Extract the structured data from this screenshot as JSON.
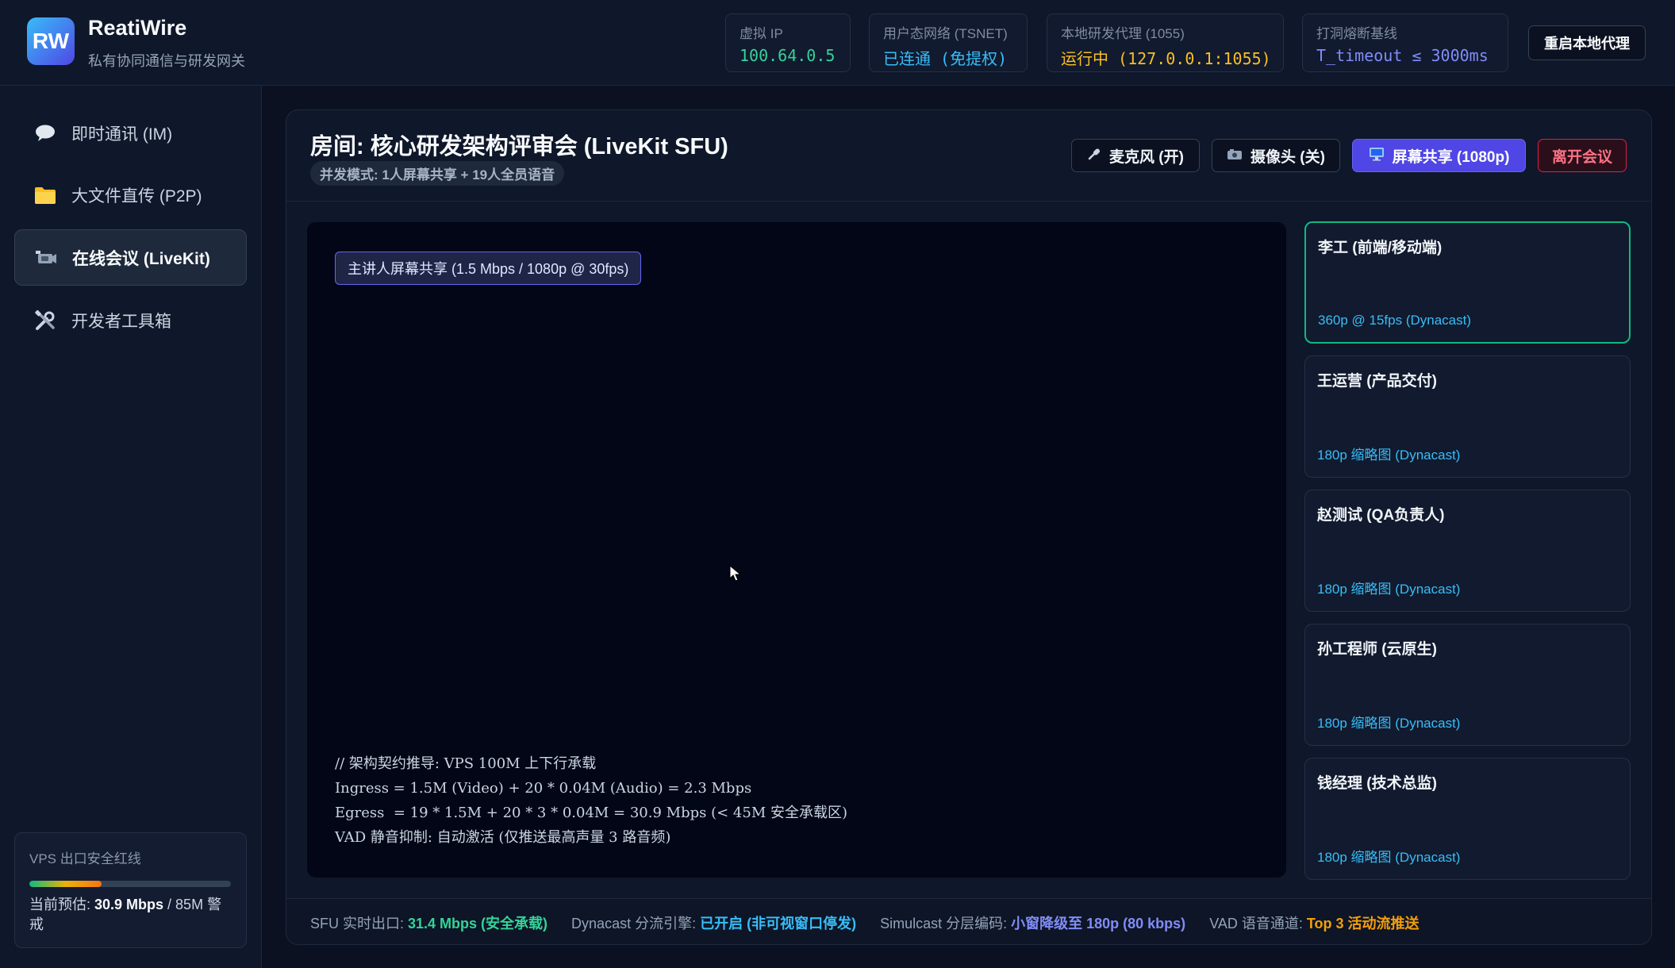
{
  "app": {
    "logo": "RW",
    "name": "ReatiWire",
    "subtitle": "私有协同通信与研发网关"
  },
  "stats": [
    {
      "label": "虚拟 IP",
      "value": "100.64.0.5",
      "color": "#34d399"
    },
    {
      "label": "用户态网络 (TSNET)",
      "value": "已连通 (免提权)",
      "color": "#38bdf8"
    },
    {
      "label": "本地研发代理 (1055)",
      "value": "运行中 (127.0.0.1:1055)",
      "color": "#fbbf24"
    },
    {
      "label": "打洞熔断基线",
      "value": "T_timeout ≤ 3000ms",
      "color": "#818cf8"
    }
  ],
  "header": {
    "restart_label": "重启本地代理"
  },
  "sidebar": {
    "items": [
      {
        "icon": "speech-bubble-icon",
        "label": "即时通讯 (IM)"
      },
      {
        "icon": "folder-icon",
        "label": "大文件直传 (P2P)"
      },
      {
        "icon": "video-camera-icon",
        "label": "在线会议 (LiveKit)"
      },
      {
        "icon": "tools-icon",
        "label": "开发者工具箱"
      }
    ],
    "active_index": 2,
    "vps": {
      "title": "VPS 出口安全红线",
      "usage_fraction": 0.36,
      "estimate_prefix": "当前预估: ",
      "estimate_value": "30.9 Mbps",
      "estimate_suffix": " / 85M 警戒"
    }
  },
  "meeting": {
    "room_title": "房间: 核心研发架构评审会 (LiveKit SFU)",
    "mode": "并发模式: 1人屏幕共享 + 19人全员语音",
    "controls": {
      "mic": "麦克风 (开)",
      "camera": "摄像头 (关)",
      "share": "屏幕共享 (1080p)",
      "leave": "离开会议"
    },
    "share_badge": "主讲人屏幕共享 (1.5 Mbps / 1080p @ 30fps)",
    "code_lines": [
      "// 架构契约推导: VPS 100M 上下行承载",
      "Ingress = 1.5M (Video) + 20 * 0.04M (Audio) = 2.3 Mbps",
      "Egress  = 19 * 1.5M + 20 * 3 * 0.04M = 30.9 Mbps (< 45M 安全承载区)",
      "VAD 静音抑制: 自动激活 (仅推送最高声量 3 路音频)"
    ],
    "participants": [
      {
        "name": "李工 (前端/移动端)",
        "quality": "360p @ 15fps (Dynacast)",
        "speaking": true
      },
      {
        "name": "王运营 (产品交付)",
        "quality": "180p 缩略图 (Dynacast)",
        "speaking": false
      },
      {
        "name": "赵测试 (QA负责人)",
        "quality": "180p 缩略图 (Dynacast)",
        "speaking": false
      },
      {
        "name": "孙工程师 (云原生)",
        "quality": "180p 缩略图 (Dynacast)",
        "speaking": false
      },
      {
        "name": "钱经理 (技术总监)",
        "quality": "180p 缩略图 (Dynacast)",
        "speaking": false
      }
    ]
  },
  "footer": [
    {
      "label": "SFU 实时出口: ",
      "value": "31.4 Mbps (安全承载)",
      "color": "#34d399"
    },
    {
      "label": "Dynacast 分流引擎: ",
      "value": "已开启 (非可视窗口停发)",
      "color": "#38bdf8"
    },
    {
      "label": "Simulcast 分层编码: ",
      "value": "小窗降级至 180p (80 kbps)",
      "color": "#818cf8"
    },
    {
      "label": "VAD 语音通道: ",
      "value": "Top 3 活动流推送",
      "color": "#f59e0b"
    }
  ]
}
